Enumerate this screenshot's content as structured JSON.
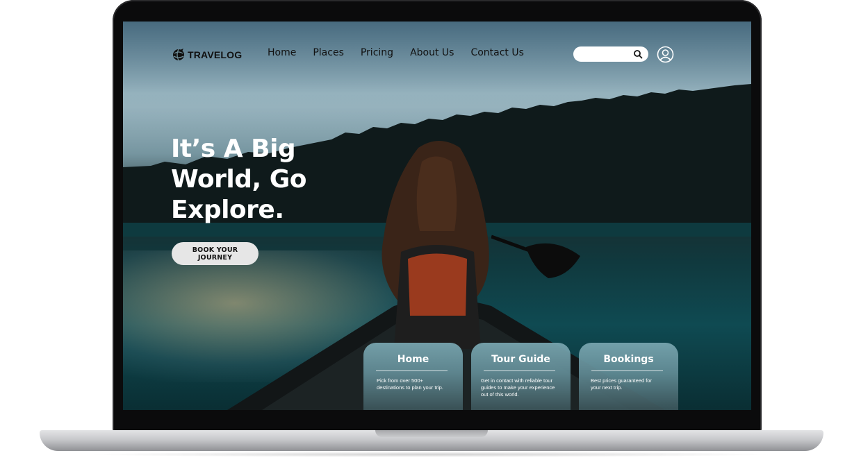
{
  "site": {
    "logo_text": "TRAVELOG"
  },
  "nav": {
    "items": [
      "Home",
      "Places",
      "Pricing",
      "About Us",
      "Contact Us"
    ]
  },
  "search": {
    "value": "",
    "placeholder": ""
  },
  "hero": {
    "title_lines": [
      "It’s A Big",
      "World, Go",
      "Explore."
    ],
    "cta_label": "BOOK YOUR JOURNEY"
  },
  "cards": [
    {
      "title": "Home",
      "text": "Pick from over 500+ destinations to plan your trip."
    },
    {
      "title": "Tour Guide",
      "text": "Get in contact with reliable tour guides to make your experience out of this world."
    },
    {
      "title": "Bookings",
      "text": "Best prices guaranteed for your next trip."
    }
  ],
  "icons": {
    "logo": "globe-plane-icon",
    "search": "search-icon",
    "user": "user-profile-icon"
  },
  "colors": {
    "nav_text": "#111111",
    "hero_text": "#ffffff",
    "cta_bg": "#e6e6e6",
    "card_top": "#78a5af",
    "card_bottom": "#3c555a"
  }
}
